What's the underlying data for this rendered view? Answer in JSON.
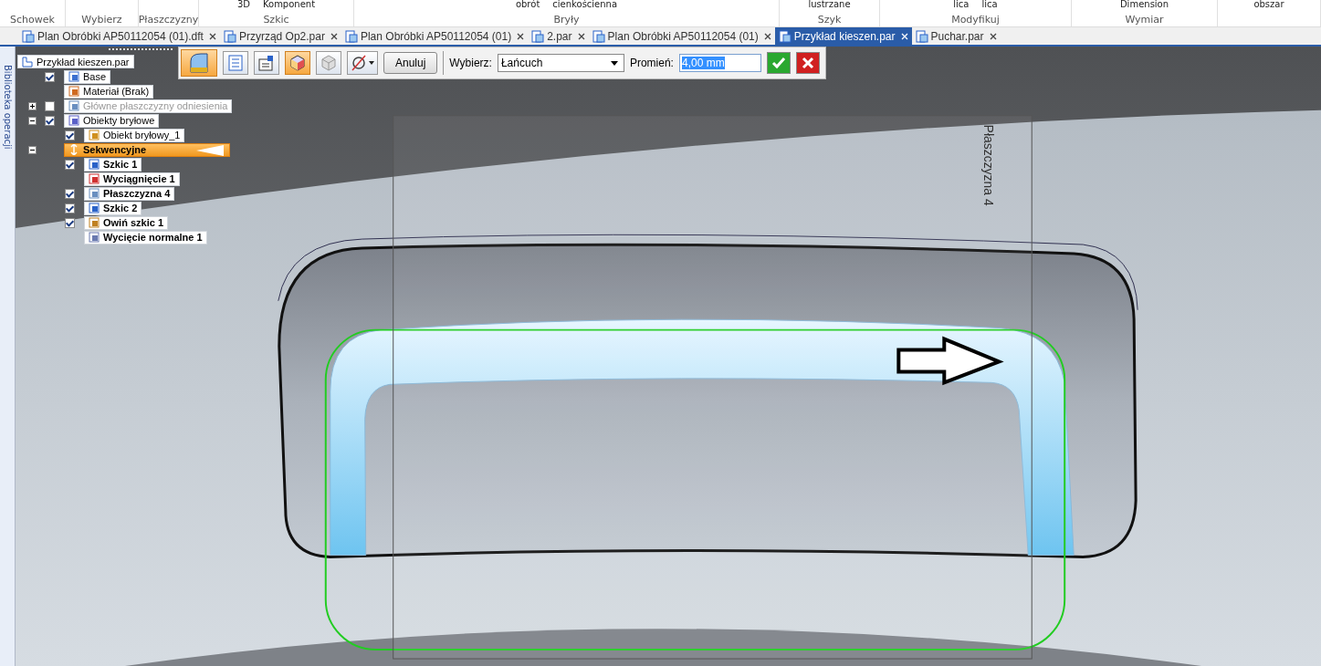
{
  "ribbon": {
    "groups": [
      {
        "label": "Schowek"
      },
      {
        "label": "Wybierz"
      },
      {
        "label": "Płaszczyzny"
      },
      {
        "label": "Szkic",
        "buttons": [
          "3D",
          "Komponent"
        ]
      },
      {
        "label": "Bryły",
        "buttons": [
          "obrót",
          "cienkościenna"
        ]
      },
      {
        "label": "Szyk",
        "buttons": [
          "lustrzane"
        ]
      },
      {
        "label": "Modyfikuj",
        "buttons": [
          "lica",
          "lica"
        ]
      },
      {
        "label": "Wymiar",
        "buttons": [
          "Dimension"
        ]
      },
      {
        "buttons": [
          "obszar"
        ]
      }
    ]
  },
  "tabs": [
    {
      "label": "Plan Obróbki AP50112054 (01).dft",
      "selected": false
    },
    {
      "label": "Przyrząd Op2.par",
      "selected": false
    },
    {
      "label": "Plan Obróbki AP50112054 (01)",
      "selected": false
    },
    {
      "label": "2.par",
      "selected": false
    },
    {
      "label": "Plan Obróbki AP50112054 (01)",
      "selected": false
    },
    {
      "label": "Przykład kieszen.par",
      "selected": true
    },
    {
      "label": "Puchar.par",
      "selected": false
    }
  ],
  "side_panel": {
    "label": "Biblioteka operacji"
  },
  "tree": {
    "label": "Przykład kieszen.par",
    "children": [
      {
        "label": "Base",
        "kind": "base",
        "checked": true
      },
      {
        "label": "Materiał (Brak)",
        "kind": "material"
      },
      {
        "label": "Główne płaszczyzny odniesienia",
        "kind": "plane",
        "checked": false,
        "expanded": false,
        "disabled": true
      },
      {
        "label": "Obiekty bryłowe",
        "kind": "bodies",
        "checked": true,
        "expanded": true,
        "children": [
          {
            "label": "Obiekt bryłowy_1",
            "kind": "body",
            "checked": true
          }
        ]
      },
      {
        "label": "Sekwencyjne",
        "kind": "group",
        "expanded": true,
        "selected": true,
        "children": [
          {
            "label": "Szkic 1",
            "kind": "sketch",
            "checked": true
          },
          {
            "label": "Wyciągnięcie 1",
            "kind": "extrude"
          },
          {
            "label": "Płaszczyzna 4",
            "kind": "plane",
            "checked": true
          },
          {
            "label": "Szkic 2",
            "kind": "sketch",
            "checked": true
          },
          {
            "label": "Owiń szkic 1",
            "kind": "wrap",
            "checked": true
          },
          {
            "label": "Wycięcie normalne 1",
            "kind": "cut"
          }
        ]
      }
    ]
  },
  "command_bar": {
    "tools": [
      {
        "kind": "step",
        "selected": true
      },
      {
        "kind": "list",
        "selected": false
      },
      {
        "kind": "edit",
        "selected": false
      },
      {
        "kind": "cube",
        "selected": true
      },
      {
        "kind": "cube-grey",
        "selected": false
      },
      {
        "kind": "options",
        "selected": false
      }
    ],
    "cancel": "Anuluj",
    "select_label": "Wybierz:",
    "select_value": "Łańcuch",
    "radius_label": "Promień:",
    "radius_value": "4,00 mm"
  },
  "viewport": {
    "plane_label": "Płaszczyzna 4"
  }
}
